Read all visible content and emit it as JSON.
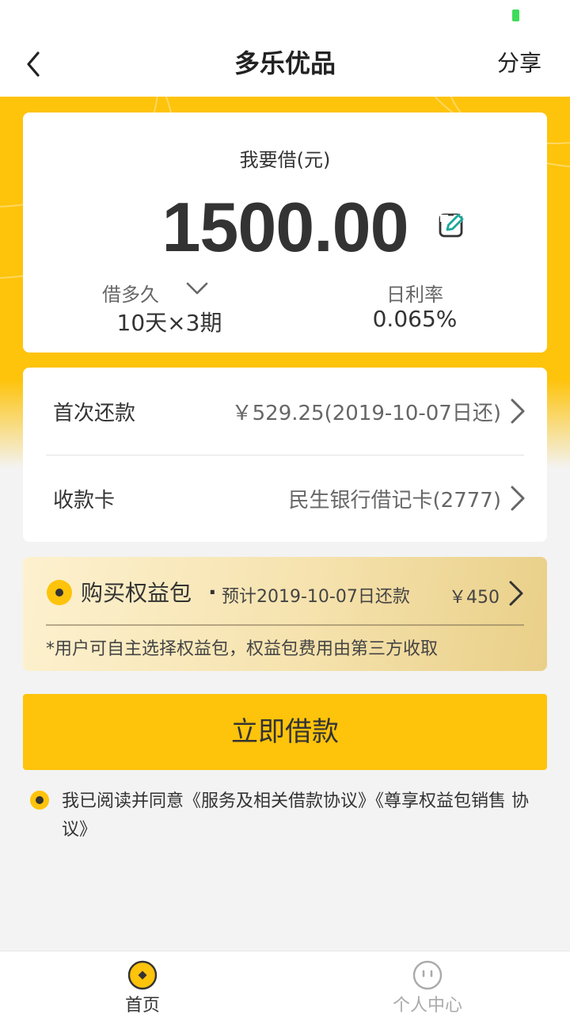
{
  "nav": {
    "title": "多乐优品",
    "share_label": "分享"
  },
  "loan": {
    "amount_label": "我要借(元)",
    "amount": "1500.00",
    "term_label": "借多久",
    "term_value": "10天×3期",
    "rate_label": "日利率",
    "rate_value": "0.065%"
  },
  "repayment": {
    "first_label": "首次还款",
    "first_value": "￥529.25(2019-10-07日还)",
    "card_label": "收款卡",
    "card_value": "民生银行借记卡(2777)"
  },
  "benefit": {
    "title": "购买权益包",
    "separator": "·",
    "subtitle": "预计2019-10-07日还款",
    "price": "￥450",
    "note": "*用户可自主选择权益包，权益包费用由第三方收取"
  },
  "cta_label": "立即借款",
  "agreement_text": "我已阅读并同意《服务及相关借款协议》《尊享权益包销售 协议》",
  "tabs": [
    {
      "label": "首页",
      "icon": "coin-icon",
      "active": true
    },
    {
      "label": "个人中心",
      "icon": "face-icon",
      "active": false
    }
  ],
  "colors": {
    "brand_yellow": "#fec30b",
    "battery_green": "#3ddc5a",
    "edit_teal": "#1aa99b"
  }
}
